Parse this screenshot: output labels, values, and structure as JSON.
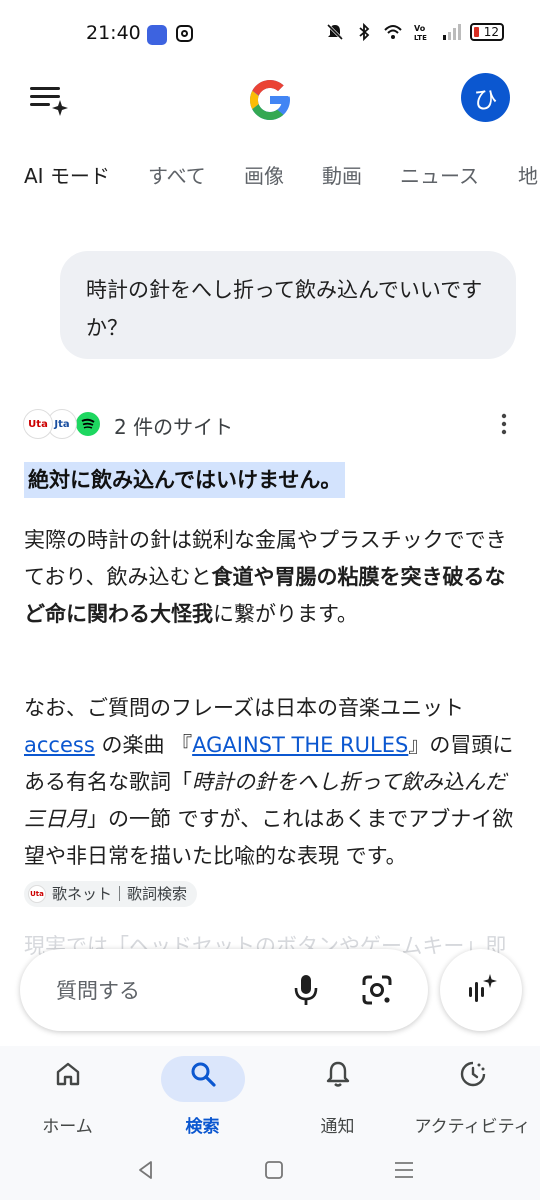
{
  "status_bar": {
    "time": "21:40",
    "battery": "12",
    "icons": [
      "hotspot-icon",
      "instagram-icon",
      "mute-icon",
      "bluetooth-icon",
      "wifi-icon",
      "volte-icon",
      "signal-icon",
      "battery-icon"
    ]
  },
  "header": {
    "avatar_letter": "ひ",
    "logo": "google-logo"
  },
  "tabs": [
    {
      "label": "AI モード",
      "active": true
    },
    {
      "label": "すべて"
    },
    {
      "label": "画像"
    },
    {
      "label": "動画"
    },
    {
      "label": "ニュース"
    },
    {
      "label": "地"
    }
  ],
  "query": "時計の針をへし折って飲み込んでいいですか？",
  "answer": {
    "source_count": "2 件のサイト",
    "source_logos": [
      "Uta",
      "Jta",
      "spotify"
    ],
    "headline": "絶対に飲み込んではいけません。",
    "p1": {
      "t1": "実際の時計の針は鋭利な金属やプラスチックでできており、飲み込むと",
      "b1": "食道や胃腸の粘膜を突き破るなど命に関わる大怪我",
      "t2": "に繋がります。"
    },
    "p2": {
      "t1": "なお、ご質問のフレーズは日本の音楽ユニット ",
      "link1": "access",
      "t2": " の楽曲 『",
      "link2": "AGAINST THE RULES",
      "t3": "』の冒頭にある有名な歌詞「",
      "i1": "時計の針をへし折って飲み込んだ三日月",
      "t4": "」の一節 ですが、これはあくまでアブナイ欲望や非日常を描いた比喩的な表現 です。",
      "chip": "歌ネット｜歌詞検索"
    },
    "faded_text": "現実では「ヘッドセットのボタンやゲームキー」即"
  },
  "ask_bar": {
    "placeholder": "質問する"
  },
  "bottom_nav": [
    {
      "label": "ホーム",
      "icon": "home-icon"
    },
    {
      "label": "検索",
      "icon": "search-icon",
      "active": true
    },
    {
      "label": "通知",
      "icon": "bell-icon"
    },
    {
      "label": "アクティビティ",
      "icon": "activity-icon"
    }
  ],
  "colors": {
    "accent": "#0b57d0",
    "highlight": "#d3e3fd",
    "bubble": "#eef0f4"
  }
}
